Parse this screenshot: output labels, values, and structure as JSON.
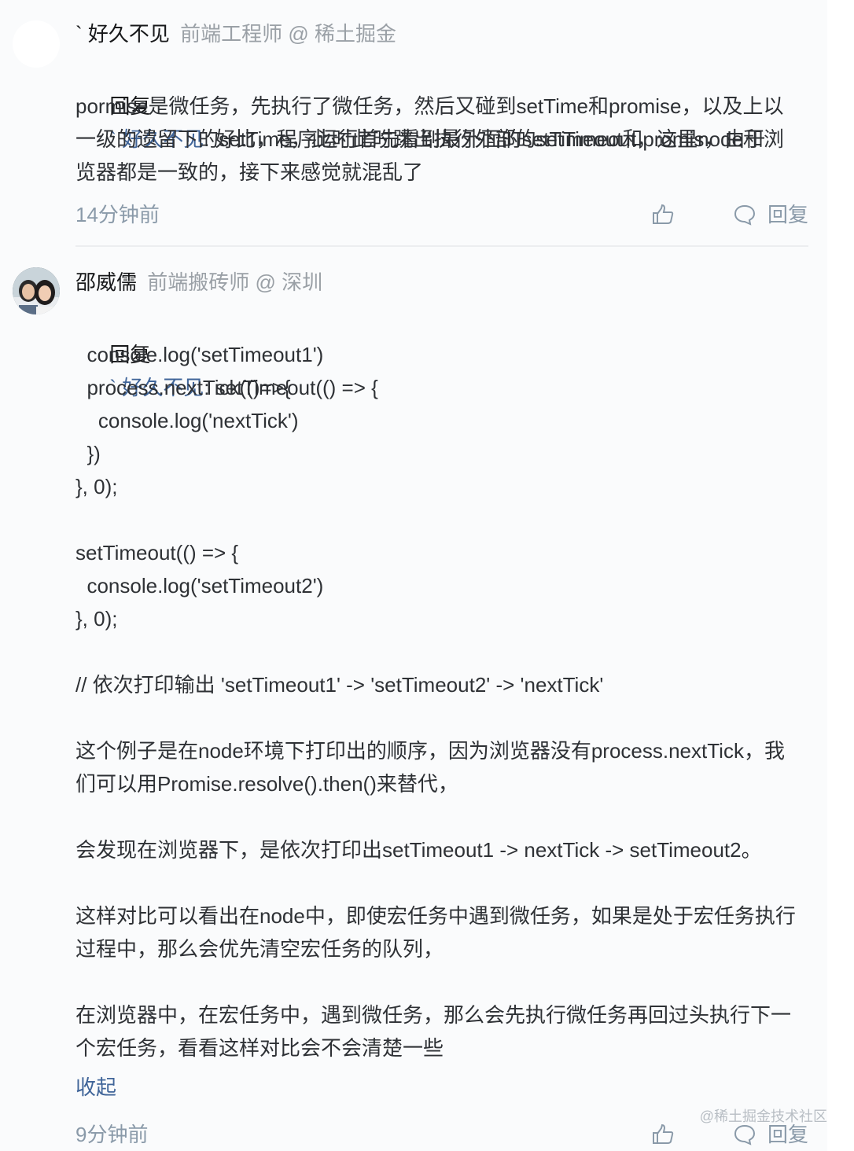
{
  "comment1": {
    "author_name": "` 好久不见",
    "author_title": "前端工程师 @ 稀土掘金",
    "reply_prefix": "回复",
    "reply_to": "` 好久不见",
    "text_lines": [
      ": 好比，程序运行首先看到最外面的setTimeout和promis，由于",
      "pormise是微任务，先执行了微任务，然后又碰到setTime和promise，以及上以",
      "一级的遗留下的setTime，此时此时跳出执行外部的setTimeout，这里node和浏",
      "览器都是一致的，接下来感觉就混乱了"
    ],
    "time": "14分钟前",
    "reply_label": "回复"
  },
  "comment2": {
    "author_name": "邵威儒",
    "author_title": "前端搬砖师 @ 深圳",
    "reply_prefix": "回复",
    "reply_to": "` 好久不见",
    "first_line": ": setTimeout(() => {",
    "code_lines": [
      "  console.log('setTimeout1')",
      "  process.nextTick(()=>{",
      "    console.log('nextTick')",
      "  })",
      "}, 0);",
      "",
      "setTimeout(() => {",
      "  console.log('setTimeout2')",
      "}, 0);",
      "",
      "// 依次打印输出 'setTimeout1' -> 'setTimeout2' -> 'nextTick'",
      ""
    ],
    "para1_lines": [
      "这个例子是在node环境下打印出的顺序，因为浏览器没有process.nextTick，我",
      "们可以用Promise.resolve().then()来替代，"
    ],
    "para2": "会发现在浏览器下，是依次打印出setTimeout1 -> nextTick -> setTimeout2。",
    "para3_lines": [
      "这样对比可以看出在node中，即使宏任务中遇到微任务，如果是处于宏任务执行",
      "过程中，那么会优先清空宏任务的队列，"
    ],
    "para4_lines": [
      "在浏览器中，在宏任务中，遇到微任务，那么会先执行微任务再回过头执行下一",
      "个宏任务，看看这样对比会不会清楚一些"
    ],
    "collapse_label": "收起",
    "time": "9分钟前",
    "reply_label": "回复"
  },
  "watermark": "@稀土掘金技术社区",
  "icons": {
    "like": "thumbs-up-icon",
    "reply": "comment-bubble-icon"
  },
  "colors": {
    "link": "#406599",
    "muted": "#8a9aa9",
    "title": "#9aa0a6"
  }
}
